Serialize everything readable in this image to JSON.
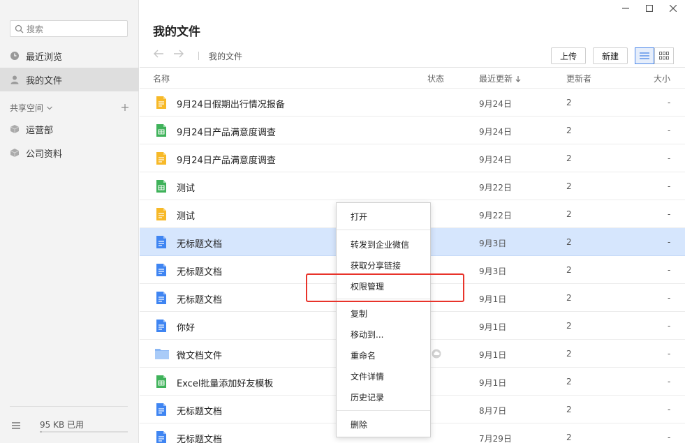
{
  "sidebar": {
    "search_placeholder": "搜索",
    "items": [
      {
        "label": "最近浏览",
        "icon": "clock-icon"
      },
      {
        "label": "我的文件",
        "icon": "user-icon",
        "active": true
      }
    ],
    "shared_section": {
      "title": "共享空间"
    },
    "shared_items": [
      {
        "label": "运营部",
        "icon": "cube-icon"
      },
      {
        "label": "公司资料",
        "icon": "cube-icon"
      }
    ],
    "storage": {
      "text": "95 KB 已用",
      "used_fraction": 0.02
    }
  },
  "main": {
    "title": "我的文件",
    "breadcrumb": "我的文件",
    "upload_label": "上传",
    "new_label": "新建",
    "columns": {
      "name": "名称",
      "status": "状态",
      "updated": "最近更新",
      "updater": "更新者",
      "size": "大小"
    }
  },
  "files": [
    {
      "name": "9月24日假期出行情况报备",
      "type": "doc-yellow",
      "date": "9月24日",
      "updater": "2",
      "size": "-"
    },
    {
      "name": "9月24日产品满意度调查",
      "type": "sheet",
      "date": "9月24日",
      "updater": "2",
      "size": "-"
    },
    {
      "name": "9月24日产品满意度调查",
      "type": "doc-yellow",
      "date": "9月24日",
      "updater": "2",
      "size": "-"
    },
    {
      "name": "测试",
      "type": "sheet",
      "date": "9月22日",
      "updater": "2",
      "size": "-"
    },
    {
      "name": "测试",
      "type": "doc-yellow",
      "date": "9月22日",
      "updater": "2",
      "size": "-"
    },
    {
      "name": "无标题文档",
      "type": "doc-blue",
      "date": "9月3日",
      "updater": "2",
      "size": "-",
      "selected": true
    },
    {
      "name": "无标题文档",
      "type": "doc-blue",
      "date": "9月3日",
      "updater": "2",
      "size": "-"
    },
    {
      "name": "无标题文档",
      "type": "doc-blue",
      "date": "9月1日",
      "updater": "2",
      "size": "-"
    },
    {
      "name": "你好",
      "type": "doc-blue",
      "date": "9月1日",
      "updater": "2",
      "size": "-"
    },
    {
      "name": "微文档文件",
      "type": "folder",
      "date": "9月1日",
      "updater": "2",
      "size": "-",
      "status": "cloud-icon"
    },
    {
      "name": "Excel批量添加好友模板",
      "type": "sheet",
      "date": "9月1日",
      "updater": "2",
      "size": "-"
    },
    {
      "name": "无标题文档",
      "type": "doc-blue",
      "date": "8月7日",
      "updater": "2",
      "size": "-"
    },
    {
      "name": "无标题文档",
      "type": "doc-blue",
      "date": "7月29日",
      "updater": "2",
      "size": "-"
    }
  ],
  "context_menu": {
    "items": [
      "打开",
      "转发到企业微信",
      "获取分享链接",
      "权限管理",
      "复制",
      "移动到...",
      "重命名",
      "文件详情",
      "历史记录",
      "删除"
    ]
  },
  "colors": {
    "accent": "#4a86e8",
    "highlight": "#e8332a",
    "selected_row": "#d6e6fd"
  }
}
